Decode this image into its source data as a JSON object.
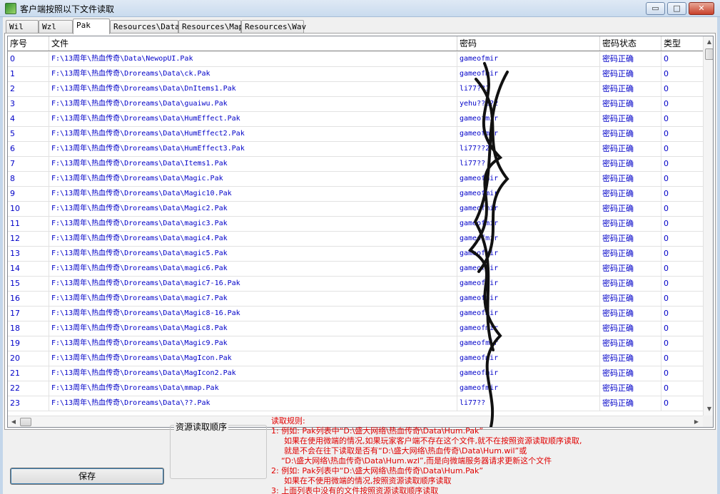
{
  "window": {
    "title": "客户端按照以下文件读取",
    "min_glyph": "▭",
    "max_glyph": "□",
    "close_glyph": "✕"
  },
  "tabs": [
    "Wil",
    "Wzl",
    "Pak",
    "Resources\\Data",
    "Resources\\Map",
    "Resources\\Wav"
  ],
  "active_tab": "Pak",
  "table": {
    "columns": [
      "序号",
      "文件",
      "密码",
      "密码状态",
      "类型"
    ],
    "rows": [
      {
        "idx": "0",
        "file": "F:\\13周年\\热血传奇\\Data\\NewopUI.Pak",
        "password": "gameofmir",
        "status": "密码正确",
        "type": "0"
      },
      {
        "idx": "1",
        "file": "F:\\13周年\\热血传奇\\Droreams\\Data\\ck.Pak",
        "password": "gameofmir",
        "status": "密码正确",
        "type": "0"
      },
      {
        "idx": "2",
        "file": "F:\\13周年\\热血传奇\\Droreams\\Data\\DnItems1.Pak",
        "password": "li77??1",
        "status": "密码正确",
        "type": "0"
      },
      {
        "idx": "3",
        "file": "F:\\13周年\\热血传奇\\Droreams\\Data\\guaiwu.Pak",
        "password": "yehu??2?2",
        "status": "密码正确",
        "type": "0"
      },
      {
        "idx": "4",
        "file": "F:\\13周年\\热血传奇\\Droreams\\Data\\HumEffect.Pak",
        "password": "gameofmir",
        "status": "密码正确",
        "type": "0"
      },
      {
        "idx": "5",
        "file": "F:\\13周年\\热血传奇\\Droreams\\Data\\HumEffect2.Pak",
        "password": "gameofmir",
        "status": "密码正确",
        "type": "0"
      },
      {
        "idx": "6",
        "file": "F:\\13周年\\热血传奇\\Droreams\\Data\\HumEffect3.Pak",
        "password": "li77??2",
        "status": "密码正确",
        "type": "0"
      },
      {
        "idx": "7",
        "file": "F:\\13周年\\热血传奇\\Droreams\\Data\\Items1.Pak",
        "password": "li77??",
        "status": "密码正确",
        "type": "0"
      },
      {
        "idx": "8",
        "file": "F:\\13周年\\热血传奇\\Droreams\\Data\\Magic.Pak",
        "password": "gameofmir",
        "status": "密码正确",
        "type": "0"
      },
      {
        "idx": "9",
        "file": "F:\\13周年\\热血传奇\\Droreams\\Data\\Magic10.Pak",
        "password": "gameofmir",
        "status": "密码正确",
        "type": "0"
      },
      {
        "idx": "10",
        "file": "F:\\13周年\\热血传奇\\Droreams\\Data\\Magic2.Pak",
        "password": "gameofmir",
        "status": "密码正确",
        "type": "0"
      },
      {
        "idx": "11",
        "file": "F:\\13周年\\热血传奇\\Droreams\\Data\\magic3.Pak",
        "password": "gameofmir",
        "status": "密码正确",
        "type": "0"
      },
      {
        "idx": "12",
        "file": "F:\\13周年\\热血传奇\\Droreams\\Data\\magic4.Pak",
        "password": "gameofmir",
        "status": "密码正确",
        "type": "0"
      },
      {
        "idx": "13",
        "file": "F:\\13周年\\热血传奇\\Droreams\\Data\\magic5.Pak",
        "password": "gameofmir",
        "status": "密码正确",
        "type": "0"
      },
      {
        "idx": "14",
        "file": "F:\\13周年\\热血传奇\\Droreams\\Data\\magic6.Pak",
        "password": "gameofmir",
        "status": "密码正确",
        "type": "0"
      },
      {
        "idx": "15",
        "file": "F:\\13周年\\热血传奇\\Droreams\\Data\\magic7-16.Pak",
        "password": "gameofmir",
        "status": "密码正确",
        "type": "0"
      },
      {
        "idx": "16",
        "file": "F:\\13周年\\热血传奇\\Droreams\\Data\\magic7.Pak",
        "password": "gameofmir",
        "status": "密码正确",
        "type": "0"
      },
      {
        "idx": "17",
        "file": "F:\\13周年\\热血传奇\\Droreams\\Data\\Magic8-16.Pak",
        "password": "gameofmir",
        "status": "密码正确",
        "type": "0"
      },
      {
        "idx": "18",
        "file": "F:\\13周年\\热血传奇\\Droreams\\Data\\Magic8.Pak",
        "password": "gameofmir",
        "status": "密码正确",
        "type": "0"
      },
      {
        "idx": "19",
        "file": "F:\\13周年\\热血传奇\\Droreams\\Data\\Magic9.Pak",
        "password": "gameofmir",
        "status": "密码正确",
        "type": "0"
      },
      {
        "idx": "20",
        "file": "F:\\13周年\\热血传奇\\Droreams\\Data\\MagIcon.Pak",
        "password": "gameofmir",
        "status": "密码正确",
        "type": "0"
      },
      {
        "idx": "21",
        "file": "F:\\13周年\\热血传奇\\Droreams\\Data\\MagIcon2.Pak",
        "password": "gameofmir",
        "status": "密码正确",
        "type": "0"
      },
      {
        "idx": "22",
        "file": "F:\\13周年\\热血传奇\\Droreams\\Data\\mmap.Pak",
        "password": "gameofmir",
        "status": "密码正确",
        "type": "0"
      },
      {
        "idx": "23",
        "file": "F:\\13周年\\热血传奇\\Droreams\\Data\\??.Pak",
        "password": "li77??",
        "status": "密码正确",
        "type": "0"
      }
    ]
  },
  "scrollbar_arrows": {
    "up": "▲",
    "down": "▼",
    "left": "◀",
    "right": "▶"
  },
  "save_button": "保存",
  "resource_group_title": "资源读取顺序",
  "rules": [
    "读取规则:",
    "1: 例如: Pak列表中“D:\\盛大网络\\热血传奇\\Data\\Hum.Pak”",
    "如果在使用微端的情况,如果玩家客户端不存在这个文件,就不在按照资源读取顺序读取,",
    "就是不会在往下读取是否有“D:\\盛大网络\\热血传奇\\Data\\Hum.wil”或",
    "“D:\\盛大网络\\热血传奇\\Data\\Hum.wzl”,而是向微端服务器请求更新这个文件",
    "2: 例如: Pak列表中“D:\\盛大网络\\热血传奇\\Data\\Hum.Pak”",
    "如果在不使用微端的情况,按照资源读取顺序读取",
    "3: 上面列表中没有的文件按照资源读取顺序读取"
  ]
}
